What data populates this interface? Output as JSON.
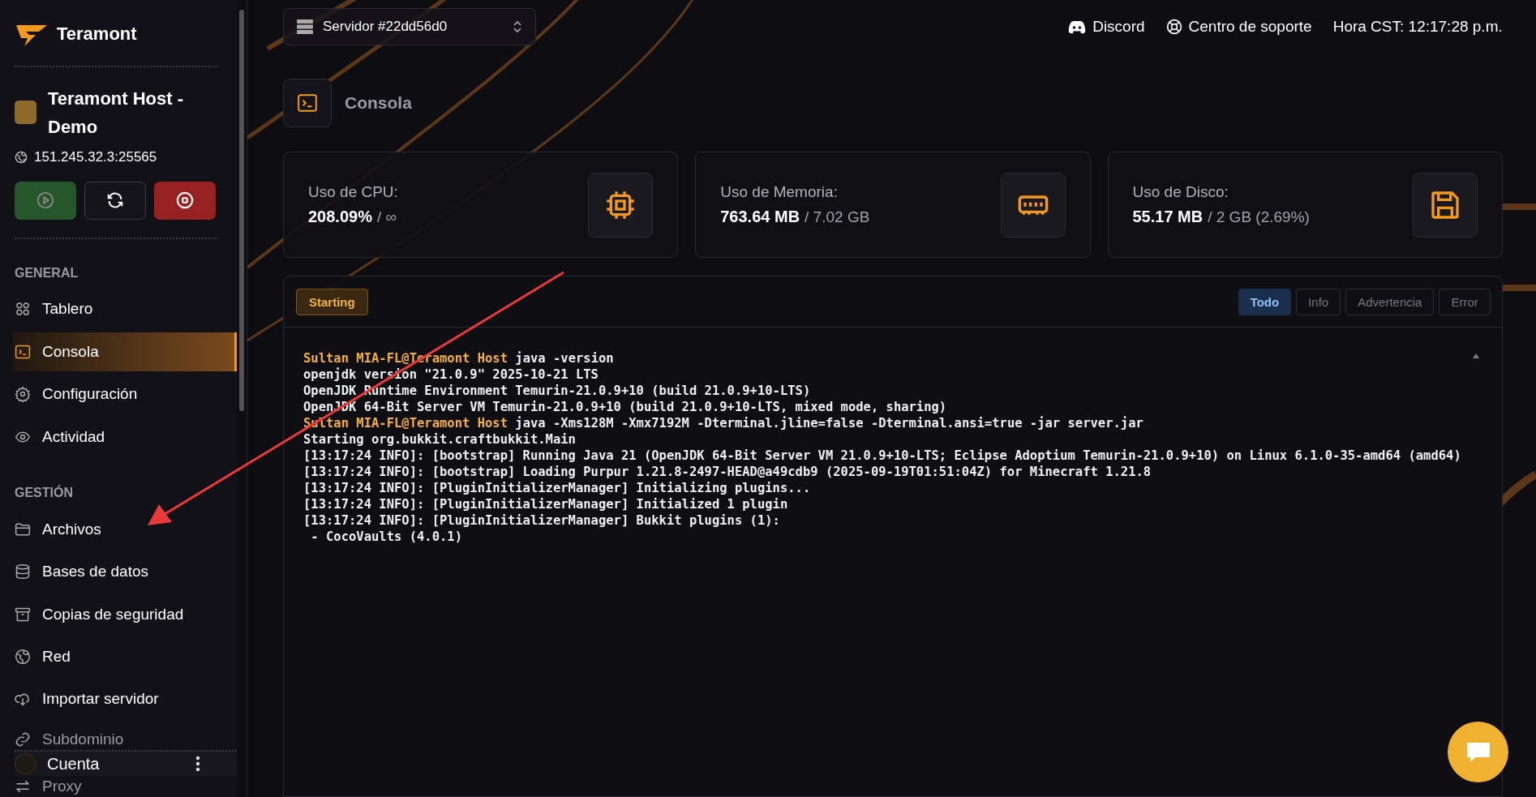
{
  "sidebar": {
    "brand": "Teramont",
    "server": {
      "name": "Teramont Host - Demo",
      "address": "151.245.32.3:25565"
    },
    "power_buttons": [
      {
        "kind": "start",
        "disabled": true
      },
      {
        "kind": "restart",
        "disabled": false
      },
      {
        "kind": "stop",
        "disabled": false
      }
    ],
    "sections": [
      {
        "heading": "GENERAL",
        "items": [
          {
            "label": "Tablero",
            "selected": false
          },
          {
            "label": "Consola",
            "selected": true
          },
          {
            "label": "Configuración",
            "selected": false
          },
          {
            "label": "Actividad",
            "selected": false
          }
        ]
      },
      {
        "heading": "GESTIÓN",
        "items": [
          {
            "label": "Archivos",
            "selected": false
          },
          {
            "label": "Bases de datos",
            "selected": false
          },
          {
            "label": "Copias de seguridad",
            "selected": false
          },
          {
            "label": "Red",
            "selected": false
          },
          {
            "label": "Importar servidor",
            "selected": false
          },
          {
            "label": "Subdominio",
            "selected": false
          },
          {
            "label": "Proxy",
            "selected": false
          }
        ]
      }
    ],
    "account": {
      "label": "Cuenta"
    }
  },
  "top_bar": {
    "server_selector": "Servidor #22dd56d0",
    "links": [
      "Discord",
      "Centro de soporte"
    ],
    "clock": "Hora CST: 12:17:28 p.m."
  },
  "page_title": "Consola",
  "stats": [
    {
      "label": "Uso de CPU:",
      "value": "208.09%",
      "limit": "/ ∞"
    },
    {
      "label": "Uso de Memoria:",
      "value": "763.64 MB",
      "limit": "/ 7.02 GB"
    },
    {
      "label": "Uso de Disco:",
      "value": "55.17 MB",
      "limit": "/ 2 GB (2.69%)"
    }
  ],
  "console": {
    "status": "Starting",
    "filters": [
      {
        "label": "Todo",
        "selected": true
      },
      {
        "label": "Info",
        "selected": false
      },
      {
        "label": "Advertencia",
        "selected": false
      },
      {
        "label": "Error",
        "selected": false
      }
    ],
    "lines": [
      {
        "prompt": "Sultan MIA-FL@Teramont Host",
        "text": "java -version"
      },
      {
        "text": "openjdk version \"21.0.9\" 2025-10-21 LTS"
      },
      {
        "text": "OpenJDK Runtime Environment Temurin-21.0.9+10 (build 21.0.9+10-LTS)"
      },
      {
        "text": "OpenJDK 64-Bit Server VM Temurin-21.0.9+10 (build 21.0.9+10-LTS, mixed mode, sharing)"
      },
      {
        "prompt": "Sultan MIA-FL@Teramont Host",
        "text": "java -Xms128M -Xmx7192M -Dterminal.jline=false -Dterminal.ansi=true -jar server.jar"
      },
      {
        "text": "Starting org.bukkit.craftbukkit.Main"
      },
      {
        "text": "[13:17:24 INFO]: [bootstrap] Running Java 21 (OpenJDK 64-Bit Server VM 21.0.9+10-LTS; Eclipse Adoptium Temurin-21.0.9+10) on Linux 6.1.0-35-amd64 (amd64)"
      },
      {
        "text": "[13:17:24 INFO]: [bootstrap] Loading Purpur 1.21.8-2497-HEAD@a49cdb9 (2025-09-19T01:51:04Z) for Minecraft 1.21.8"
      },
      {
        "text": "[13:17:24 INFO]: [PluginInitializerManager] Initializing plugins..."
      },
      {
        "text": "[13:17:24 INFO]: [PluginInitializerManager] Initialized 1 plugin"
      },
      {
        "text": "[13:17:24 INFO]: [PluginInitializerManager] Bukkit plugins (1):"
      },
      {
        "text": " - CocoVaults (4.0.1)"
      }
    ]
  }
}
